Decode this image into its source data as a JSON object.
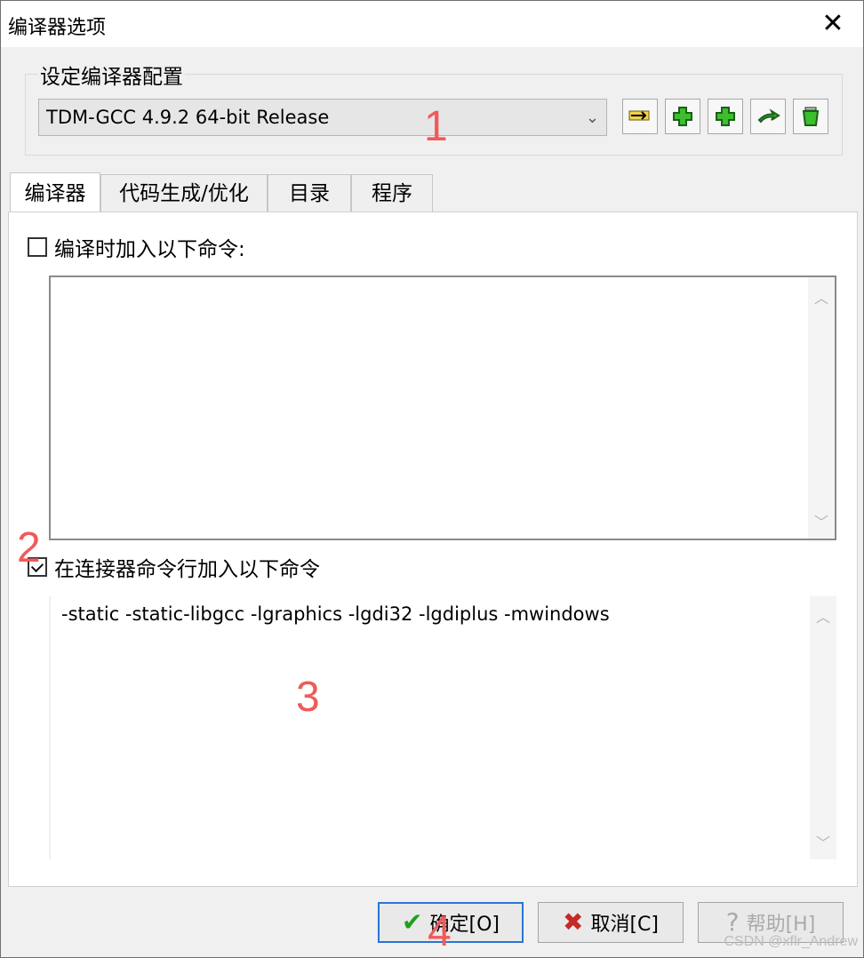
{
  "window": {
    "title": "编译器选项",
    "close": "✕"
  },
  "group": {
    "legend": "设定编译器配置"
  },
  "combo": {
    "value": "TDM-GCC 4.9.2 64-bit Release",
    "arrow": "⌄"
  },
  "toolbar": {
    "icons": [
      "rename-icon",
      "add-icon",
      "add-icon",
      "export-icon",
      "delete-icon"
    ]
  },
  "tabs": [
    {
      "label": "编译器"
    },
    {
      "label": "代码生成/优化"
    },
    {
      "label": "目录"
    },
    {
      "label": "程序"
    }
  ],
  "compiler_tab": {
    "compile_cmd_label": "编译时加入以下命令:",
    "compile_cmd_checked": false,
    "compile_cmd_text": "",
    "linker_cmd_label": "在连接器命令行加入以下命令",
    "linker_cmd_checked": true,
    "linker_cmd_text": "-static -static-libgcc -lgraphics -lgdi32 -lgdiplus -mwindows"
  },
  "scroll": {
    "up": "︿",
    "down": "﹀"
  },
  "annotations": {
    "a1": "1",
    "a2": "2",
    "a3": "3",
    "a4": "4"
  },
  "footer": {
    "ok_label": "确定[O]",
    "cancel_label": "取消[C]",
    "help_label": "帮助[H]",
    "ok_icon": "✔",
    "cancel_icon": "✖",
    "help_icon": "?"
  },
  "watermark": "CSDN @xflr_Andrew"
}
